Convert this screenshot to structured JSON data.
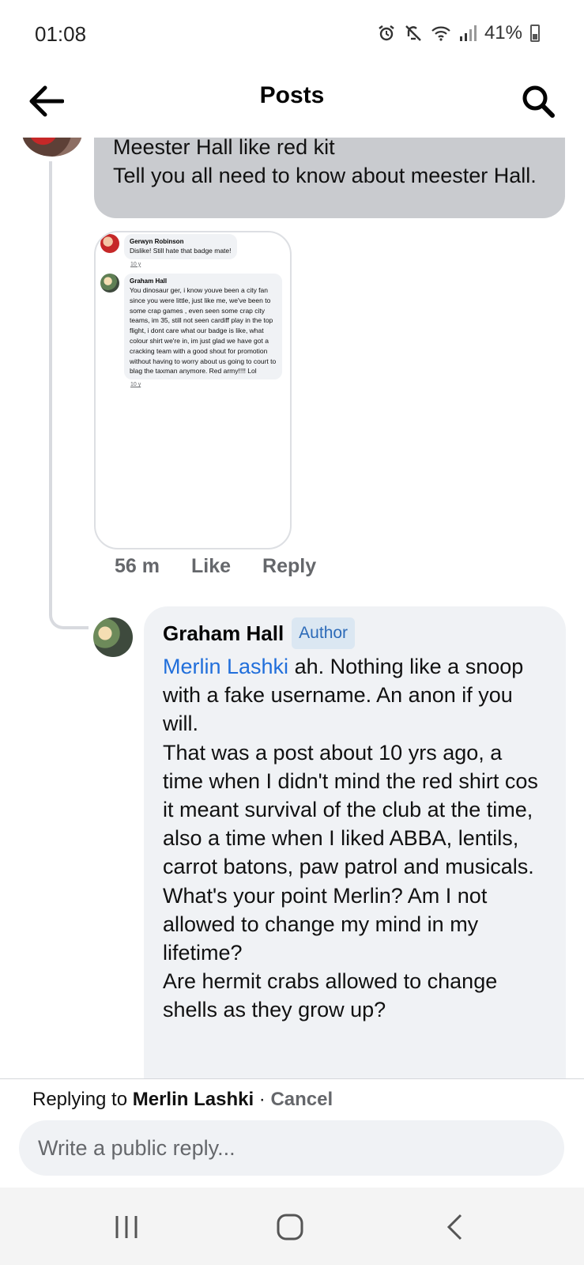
{
  "status_bar": {
    "time": "01:08",
    "battery": "41%"
  },
  "header": {
    "title": "Posts"
  },
  "top_comment": {
    "text": "Meester Hall like red kit\nTell you all need to know about meester Hall.",
    "screenshot": {
      "comments": [
        {
          "name": "Gerwyn Robinson",
          "text": "Dislike! Still hate that badge mate!",
          "time": "10 y"
        },
        {
          "name": "Graham Hall",
          "text": "You dinosaur ger, i know youve been a city fan since you were little, just like me, we've been to some crap games , even seen some crap city teams, im 35, still not seen cardiff play in the top flight, i dont care what our badge is like, what colour shirt we're in, im just glad we have got a cracking team with a good shout for promotion without having to worry about us going to court to blag the taxman anymore. Red army!!!! Lol",
          "time": "10 y"
        }
      ]
    },
    "time": "56 m",
    "like_label": "Like",
    "reply_label": "Reply"
  },
  "reply": {
    "author": "Graham Hall",
    "badge": "Author",
    "mention": "Merlin Lashki",
    "text": " ah. Nothing like a snoop with a fake username. An anon if you will.\nThat was a post about 10 yrs ago, a time when I didn't mind the red shirt cos it meant survival of the club at the time, also a time when I liked ABBA, lentils,  carrot batons, paw patrol and musicals.\nWhat's your point Merlin? Am I not allowed to change my mind in my lifetime?\nAre hermit crabs allowed to change shells as they grow up?"
  },
  "composer": {
    "replying_prefix": "Replying to ",
    "replying_name": "Merlin Lashki",
    "separator": " · ",
    "cancel_label": "Cancel",
    "placeholder": "Write a public reply..."
  },
  "icons": {
    "back": "arrow-left-icon",
    "search": "search-icon",
    "nav_recents": "recents-icon",
    "nav_home": "home-icon",
    "nav_back": "chevron-left-icon"
  },
  "colors": {
    "link": "#216fdb",
    "author_badge_bg": "#dbe7f2",
    "bubble_bg": "#f0f2f5",
    "highlight_bubble_bg": "#c9cbcf"
  }
}
